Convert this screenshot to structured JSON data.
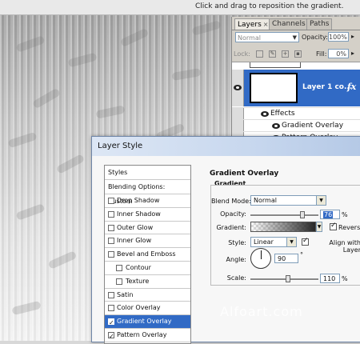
{
  "hint": "Click and drag to reposition the gradient.",
  "layers_panel": {
    "tabs": [
      {
        "label": "Layers",
        "close": "×"
      },
      {
        "label": "Channels"
      },
      {
        "label": "Paths"
      }
    ],
    "blend_mode": "Normal",
    "opacity_label": "Opacity:",
    "opacity_value": "100%",
    "lock_label": "Lock:",
    "fill_label": "Fill:",
    "fill_value": "0%",
    "layer_name": "Layer 1 co...",
    "fx_label": "fx",
    "effects_label": "Effects",
    "effects": [
      "Gradient Overlay",
      "Pattern Overlay"
    ]
  },
  "dialog": {
    "title": "Layer Style",
    "styles_header": "Styles",
    "blending_options": "Blending Options: Custom",
    "items": [
      {
        "label": "Drop Shadow",
        "checked": false,
        "indent": false,
        "selected": false
      },
      {
        "label": "Inner Shadow",
        "checked": false,
        "indent": false,
        "selected": false
      },
      {
        "label": "Outer Glow",
        "checked": false,
        "indent": false,
        "selected": false
      },
      {
        "label": "Inner Glow",
        "checked": false,
        "indent": false,
        "selected": false
      },
      {
        "label": "Bevel and Emboss",
        "checked": false,
        "indent": false,
        "selected": false
      },
      {
        "label": "Contour",
        "checked": false,
        "indent": true,
        "selected": false
      },
      {
        "label": "Texture",
        "checked": false,
        "indent": true,
        "selected": false
      },
      {
        "label": "Satin",
        "checked": false,
        "indent": false,
        "selected": false
      },
      {
        "label": "Color Overlay",
        "checked": false,
        "indent": false,
        "selected": false
      },
      {
        "label": "Gradient Overlay",
        "checked": true,
        "indent": false,
        "selected": true
      },
      {
        "label": "Pattern Overlay",
        "checked": true,
        "indent": false,
        "selected": false
      }
    ],
    "section_title": "Gradient Overlay",
    "section_sub": "Gradient",
    "blend_mode_label": "Blend Mode:",
    "blend_mode_value": "Normal",
    "opacity_label": "Opacity:",
    "opacity_value": "76",
    "percent": "%",
    "gradient_label": "Gradient:",
    "reverse_label": "Reverse",
    "reverse_checked": true,
    "style_label": "Style:",
    "style_value": "Linear",
    "align_label": "Align with Layer",
    "align_checked": true,
    "angle_label": "Angle:",
    "angle_value": "90",
    "degree": "°",
    "scale_label": "Scale:",
    "scale_value": "110",
    "opacity_fraction": 0.76,
    "scale_fraction": 0.55
  },
  "watermark": "Alfoart.com"
}
